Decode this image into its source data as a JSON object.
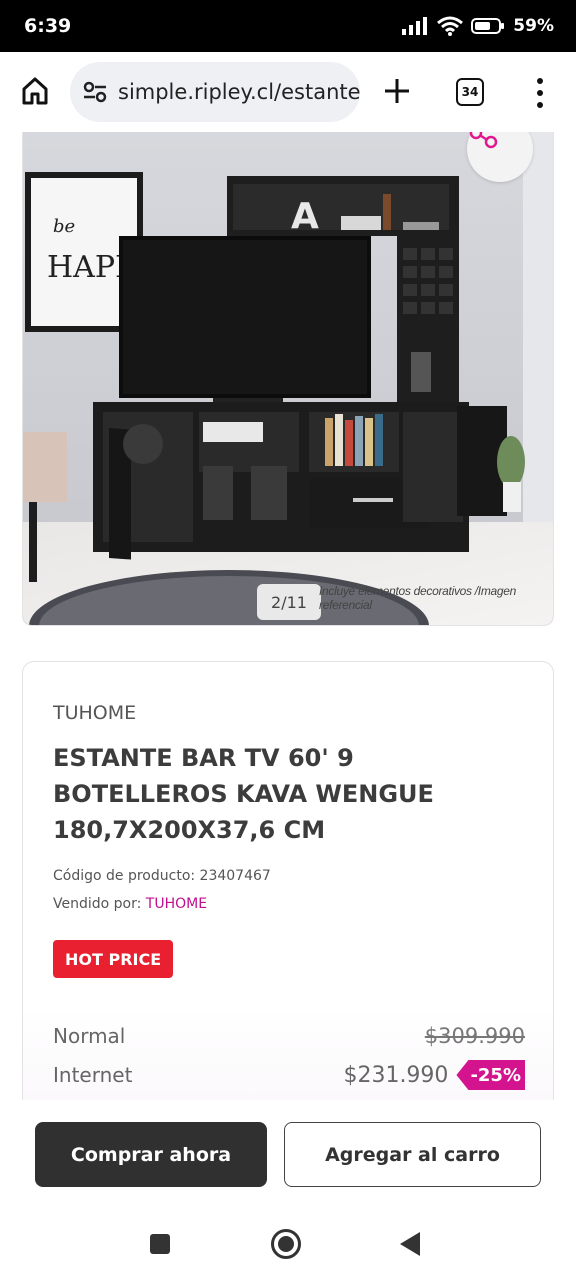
{
  "status_bar": {
    "time": "6:39",
    "battery_pct": "59%"
  },
  "browser": {
    "url": "simple.ripley.cl/estante",
    "tab_count": "34"
  },
  "gallery": {
    "counter": "2/11",
    "caption": "Incluye elementos decorativos /Imagen referencial",
    "poster_text_1": "be",
    "poster_text_2": "HAPPY",
    "letter_decor": "A"
  },
  "product": {
    "brand": "TUHOME",
    "title": "ESTANTE BAR TV 60' 9 BOTELLEROS KAVA WENGUE 180,7X200X37,6 CM",
    "code_text": "Código de producto: 23407467",
    "sold_by_label": "Vendido por: ",
    "seller": "TUHOME",
    "badge": "HOT PRICE"
  },
  "prices": {
    "normal_label": "Normal",
    "normal_value": "$309.990",
    "internet_label": "Internet",
    "internet_value": "$231.990",
    "discount": "-25%"
  },
  "actions": {
    "buy_now": "Comprar ahora",
    "add_to_cart": "Agregar al carro"
  },
  "colors": {
    "accent": "#d4148e",
    "hot": "#e8202f",
    "dark_button": "#303030"
  },
  "icons": [
    "home-icon",
    "site-settings-icon",
    "plus-icon",
    "tabs-icon",
    "more-vert-icon",
    "share-icon",
    "signal-icon",
    "wifi-icon",
    "battery-icon"
  ]
}
